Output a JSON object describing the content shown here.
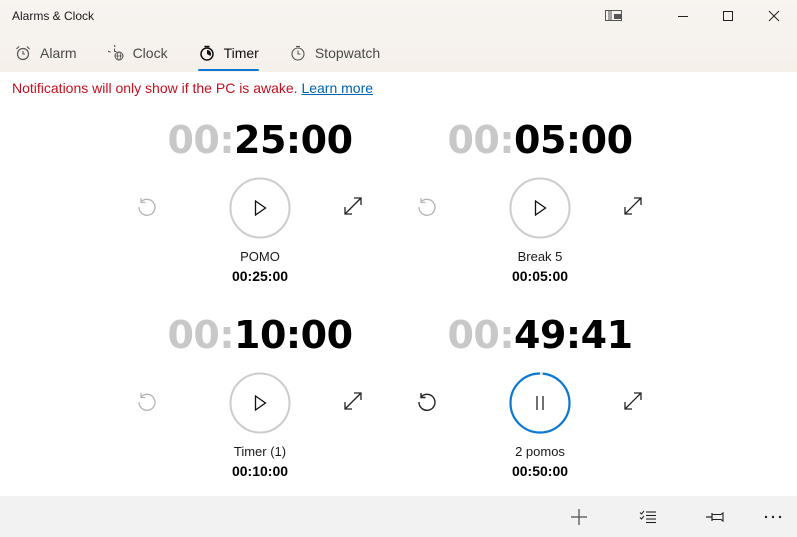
{
  "window": {
    "title": "Alarms & Clock",
    "controls": [
      "compact-overlay",
      "minimize",
      "maximize",
      "close"
    ]
  },
  "tabs": [
    {
      "label": "Alarm",
      "icon": "alarm-clock-icon",
      "active": false
    },
    {
      "label": "Clock",
      "icon": "world-clock-icon",
      "active": false
    },
    {
      "label": "Timer",
      "icon": "timer-icon",
      "active": true
    },
    {
      "label": "Stopwatch",
      "icon": "stopwatch-icon",
      "active": false
    }
  ],
  "notice": {
    "text": "Notifications will only show if the PC is awake.",
    "link": "Learn more"
  },
  "timers": [
    {
      "name": "POMO",
      "duration": "00:25:00",
      "hours": "00:",
      "rest": "25:00",
      "state": "stopped",
      "progress": 1.0
    },
    {
      "name": "Break 5",
      "duration": "00:05:00",
      "hours": "00:",
      "rest": "05:00",
      "state": "stopped",
      "progress": 1.0
    },
    {
      "name": "Timer (1)",
      "duration": "00:10:00",
      "hours": "00:",
      "rest": "10:00",
      "state": "stopped",
      "progress": 1.0
    },
    {
      "name": "2 pomos",
      "duration": "00:50:00",
      "hours": "00:",
      "rest": "49:41",
      "state": "running",
      "progress": 0.9937
    }
  ],
  "colors": {
    "accent": "#0a78d4",
    "notice": "#c50f1f",
    "link": "#0063b1",
    "dim_hours": "#c8c8c8"
  },
  "commandbar": {
    "items": [
      {
        "name": "add-timer",
        "icon": "plus-icon"
      },
      {
        "name": "select-timers",
        "icon": "checklist-icon"
      },
      {
        "name": "pin-to-start",
        "icon": "pin-icon"
      },
      {
        "name": "more",
        "icon": "more-icon"
      }
    ]
  }
}
